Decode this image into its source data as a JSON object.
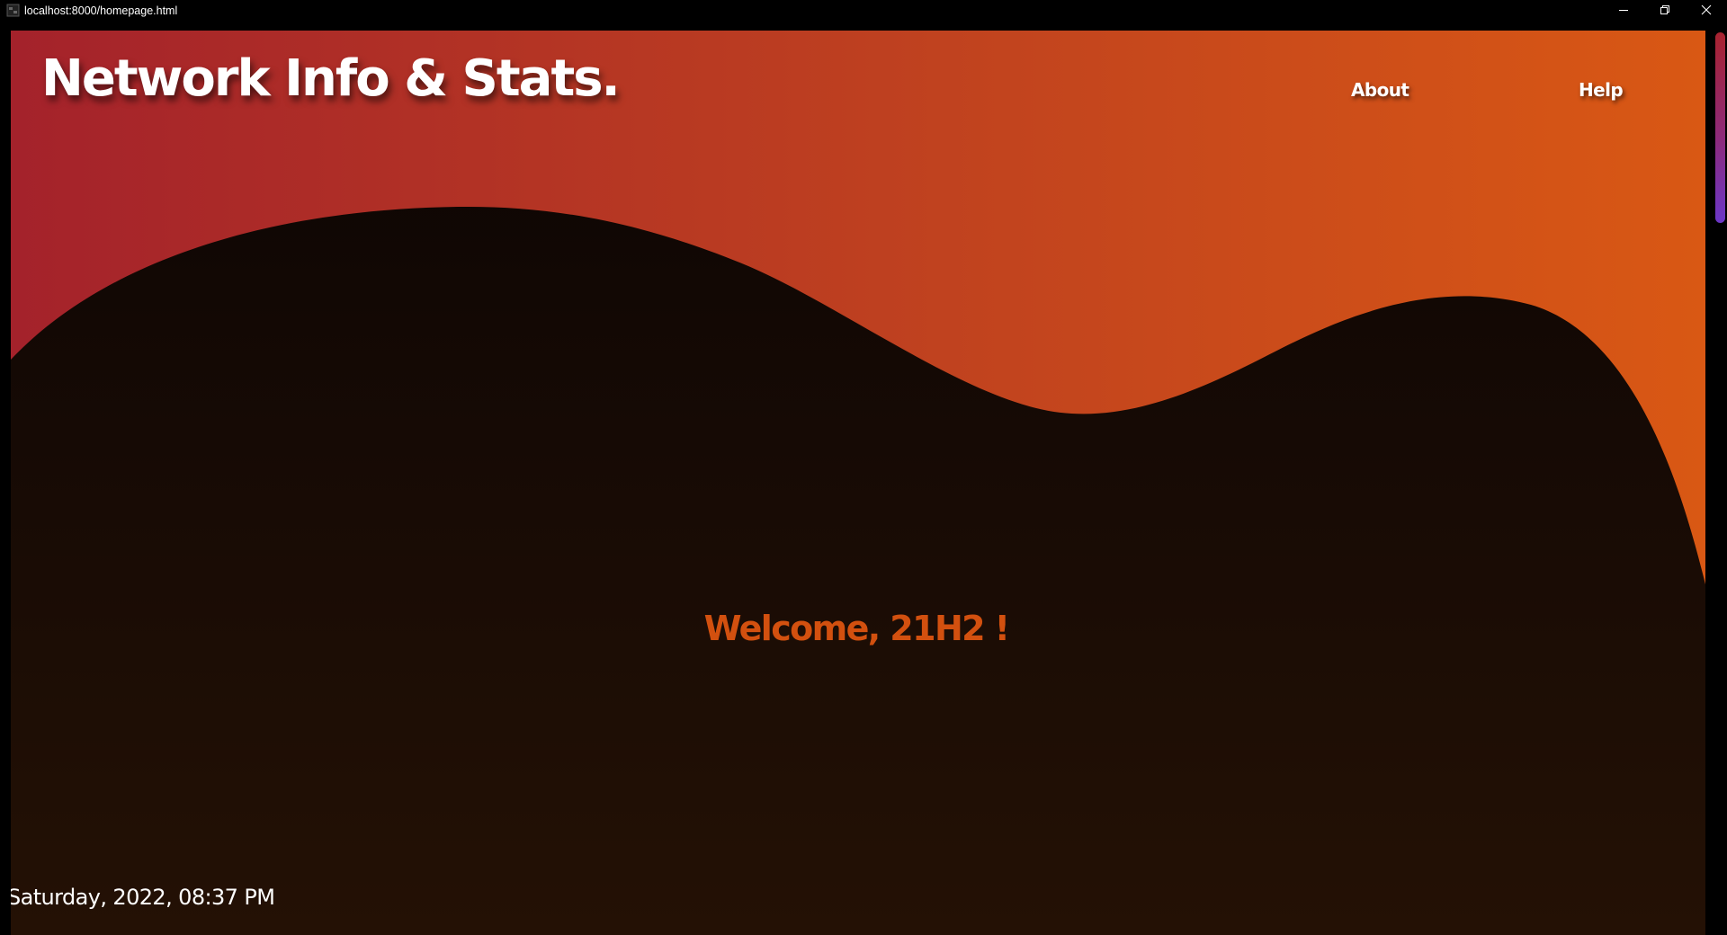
{
  "window": {
    "title": "localhost:8000/homepage.html",
    "icons": {
      "app": "app-icon",
      "minimize": "minimize-icon",
      "maximize": "restore-icon",
      "close": "close-icon"
    }
  },
  "header": {
    "logo": "Network Info & Stats.",
    "nav": {
      "about": "About",
      "help": "Help"
    }
  },
  "main": {
    "welcome": "Welcome, 21H2 !"
  },
  "footer": {
    "datetime": "Saturday, 2022, 08:37 PM"
  },
  "colors": {
    "gradient_start": "#a4222b",
    "gradient_end": "#d95814",
    "background_top": "#0b0402",
    "background_bottom": "#241105",
    "welcome_text": "#d2500f",
    "scrollbar_thumb": "#8d2a7a"
  }
}
